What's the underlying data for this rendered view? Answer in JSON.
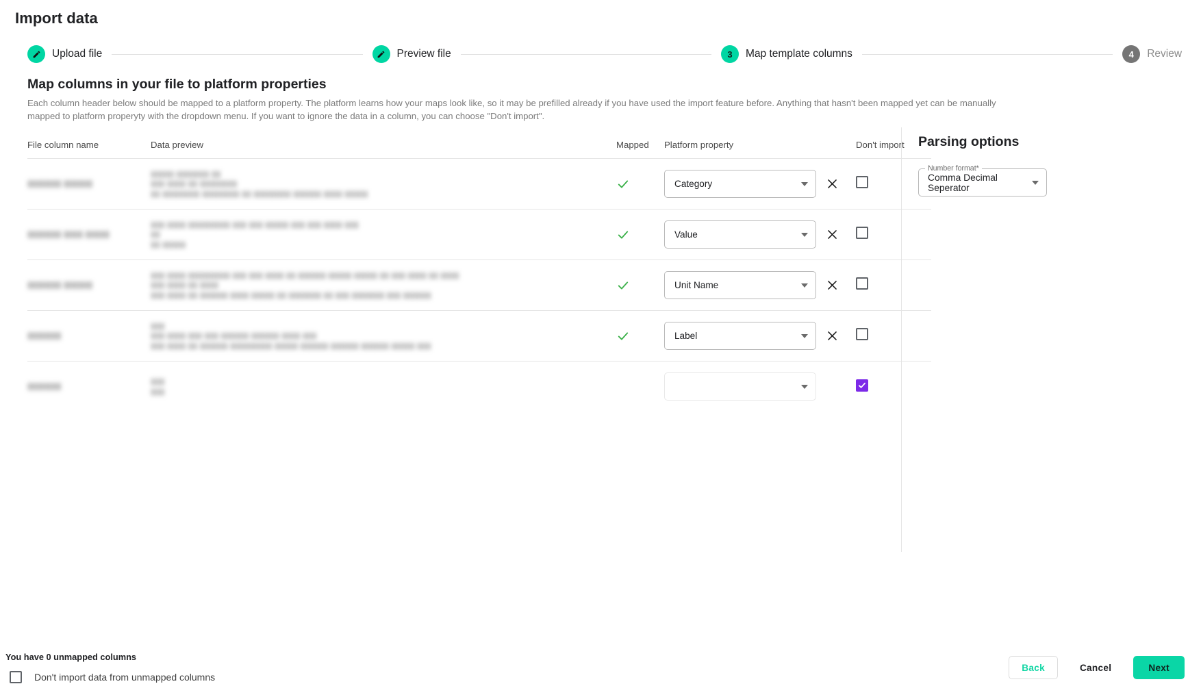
{
  "window": {
    "title": "Import data"
  },
  "stepper": {
    "steps": [
      {
        "label": "Upload file",
        "state": "done",
        "icon": "pencil-icon",
        "number": "1"
      },
      {
        "label": "Preview file",
        "state": "done",
        "icon": "pencil-icon",
        "number": "2"
      },
      {
        "label": "Map template columns",
        "state": "active",
        "icon": "number",
        "number": "3"
      },
      {
        "label": "Review",
        "state": "todo",
        "icon": "number",
        "number": "4"
      }
    ]
  },
  "main": {
    "headline": "Map columns in your file to platform properties",
    "description": "Each column header below should be mapped to a platform property. The platform learns how your maps look like, so it may be prefilled already if you have used the import feature before. Anything that hasn't been mapped yet can be manually mapped to platform properyty with the dropdown menu. If you want to ignore the data in a column, you can choose \"Don't import\".",
    "table": {
      "headers": {
        "file_column_name": "File column name",
        "data_preview": "Data preview",
        "mapped": "Mapped",
        "platform_property": "Platform property",
        "dont_import": "Don't import"
      },
      "rows": [
        {
          "file_column_name": "▮▮▮▮▮▮▮ ▮▮▮▮▮▮",
          "data_preview": "▮▮▮▮▮ ▮▮▮▮▮▮▮ ▮▮\n▮▮▮ ▮▮▮▮ ▮▮ ▮▮▮▮▮▮▮▮\n▮▮ ▮▮▮▮▮▮▮▮  ▮▮▮▮▮▮▮▮ ▮▮ ▮▮▮▮▮▮▮▮ ▮▮▮▮▮▮ ▮▮▮▮ ▮▮▮▮▮",
          "mapped": true,
          "mapped_icon": "check-icon",
          "platform_property": "Category",
          "dont_import": false
        },
        {
          "file_column_name": "▮▮▮▮▮▮▮ ▮▮▮▮ ▮▮▮▮▮",
          "data_preview": "▮▮▮ ▮▮▮▮ ▮▮▮▮▮▮▮▮▮ ▮▮▮ ▮▮▮ ▮▮▮▮▮ ▮▮▮ ▮▮▮ ▮▮▮▮ ▮▮▮\n▮▮\n▮▮ ▮▮▮▮▮",
          "mapped": true,
          "mapped_icon": "check-icon",
          "platform_property": "Value",
          "dont_import": false
        },
        {
          "file_column_name": "▮▮▮▮▮▮▮ ▮▮▮▮▮▮",
          "data_preview": "▮▮▮ ▮▮▮▮ ▮▮▮▮▮▮▮▮▮ ▮▮▮ ▮▮▮ ▮▮▮▮ ▮▮ ▮▮▮▮▮▮ ▮▮▮▮▮ ▮▮▮▮▮ ▮▮ ▮▮▮ ▮▮▮▮ ▮▮ ▮▮▮▮\n▮▮▮ ▮▮▮▮ ▮▮ ▮▮▮▮\n▮▮▮ ▮▮▮▮ ▮▮ ▮▮▮▮▮▮ ▮▮▮▮ ▮▮▮▮▮ ▮▮ ▮▮▮▮▮▮▮ ▮▮ ▮▮▮ ▮▮▮▮▮▮▮ ▮▮▮ ▮▮▮▮▮▮",
          "mapped": true,
          "mapped_icon": "check-icon",
          "platform_property": "Unit Name",
          "dont_import": false
        },
        {
          "file_column_name": "▮▮▮▮▮▮▮",
          "data_preview": "▮▮▮\n▮▮▮ ▮▮▮▮ ▮▮▮ ▮▮▮ ▮▮▮▮▮▮ ▮▮▮▮▮▮ ▮▮▮▮ ▮▮▮\n▮▮▮ ▮▮▮▮ ▮▮ ▮▮▮▮▮▮ ▮▮▮▮▮▮▮▮▮ ▮▮▮▮▮ ▮▮▮▮▮▮ ▮▮▮▮▮▮ ▮▮▮▮▮▮ ▮▮▮▮▮ ▮▮▮",
          "mapped": true,
          "mapped_icon": "check-icon",
          "platform_property": "Label",
          "dont_import": false
        },
        {
          "file_column_name": "▮▮▮▮▮▮▮",
          "data_preview": "▮▮▮\n▮▮▮",
          "mapped": false,
          "mapped_icon": "",
          "platform_property": "",
          "dont_import": true
        }
      ]
    }
  },
  "parsing_options": {
    "title": "Parsing options",
    "number_format": {
      "label": "Number format*",
      "value": "Comma Decimal Seperator"
    }
  },
  "footer": {
    "unmapped_text": "You have 0 unmapped columns",
    "dont_import_unmapped_label": "Don't import data from unmapped columns",
    "dont_import_unmapped_checked": false,
    "back_label": "Back",
    "cancel_label": "Cancel",
    "next_label": "Next"
  },
  "colors": {
    "accent_teal": "#0ad6a6",
    "check_green": "#3cb14a",
    "checkbox_purple": "#7c2ae8",
    "inactive_grey": "#757575"
  }
}
